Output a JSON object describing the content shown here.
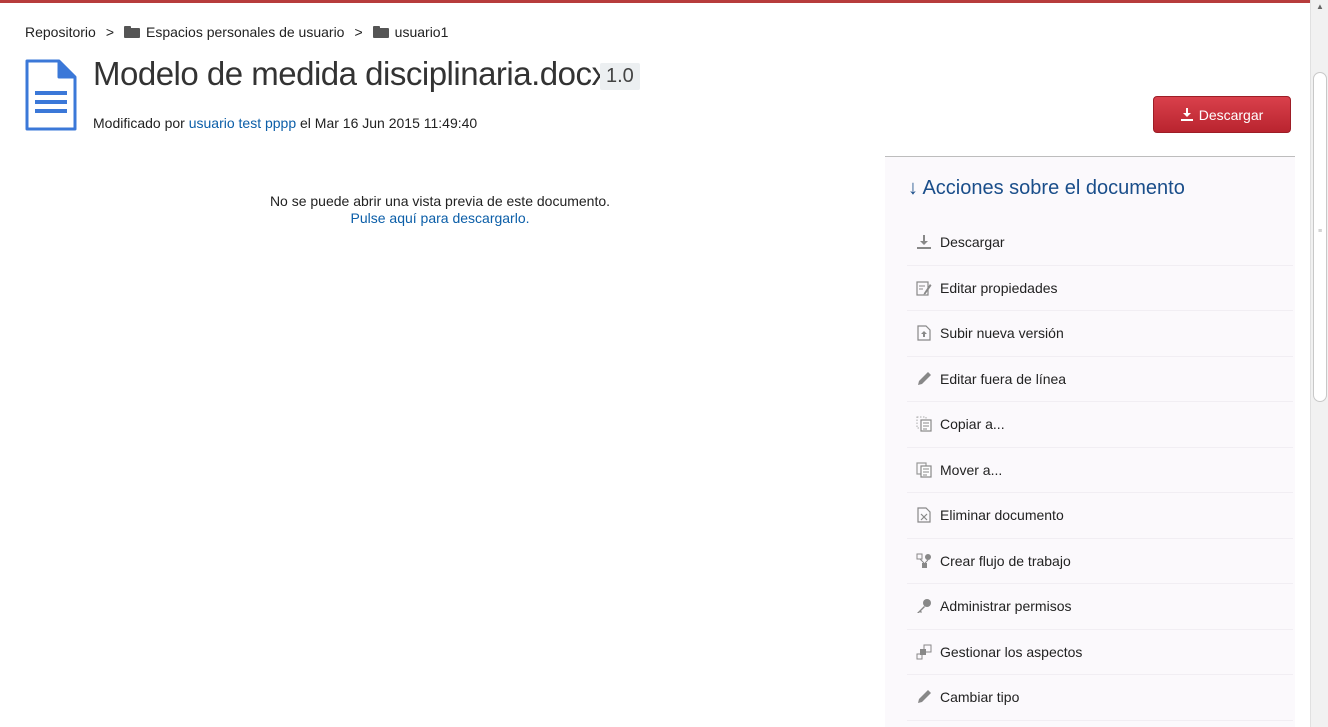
{
  "breadcrumb": {
    "root": "Repositorio",
    "separator": ">",
    "items": [
      {
        "label": "Espacios personales de usuario",
        "icon": "folder-icon"
      },
      {
        "label": "usuario1",
        "icon": "folder-icon"
      }
    ]
  },
  "document": {
    "title": "Modelo de medida disciplinaria.docx",
    "version": "1.0",
    "modified_prefix": "Modificado por",
    "modified_user": "usuario test pppp",
    "modified_date": "el Mar 16 Jun 2015 11:49:40",
    "icon": "document-icon"
  },
  "download_button": {
    "label": "Descargar",
    "icon": "download-icon"
  },
  "preview": {
    "message": "No se puede abrir una vista previa de este documento.",
    "link": "Pulse aquí para descargarlo."
  },
  "actions_panel": {
    "title": "Acciones sobre el documento",
    "title_icon": "arrow-down-icon",
    "items": [
      {
        "label": "Descargar",
        "icon": "download-icon"
      },
      {
        "label": "Editar propiedades",
        "icon": "edit-properties-icon"
      },
      {
        "label": "Subir nueva versión",
        "icon": "upload-version-icon"
      },
      {
        "label": "Editar fuera de línea",
        "icon": "pencil-icon"
      },
      {
        "label": "Copiar a...",
        "icon": "copy-icon"
      },
      {
        "label": "Mover a...",
        "icon": "move-icon"
      },
      {
        "label": "Eliminar documento",
        "icon": "delete-icon"
      },
      {
        "label": "Crear flujo de trabajo",
        "icon": "workflow-icon"
      },
      {
        "label": "Administrar permisos",
        "icon": "key-icon"
      },
      {
        "label": "Gestionar los aspectos",
        "icon": "aspects-icon"
      },
      {
        "label": "Cambiar tipo",
        "icon": "pencil-icon"
      }
    ]
  },
  "colors": {
    "accent_red": "#c4303a",
    "link_blue": "#0b5ea8",
    "panel_title": "#1a4e8a",
    "doc_icon_blue": "#3b78d8"
  }
}
